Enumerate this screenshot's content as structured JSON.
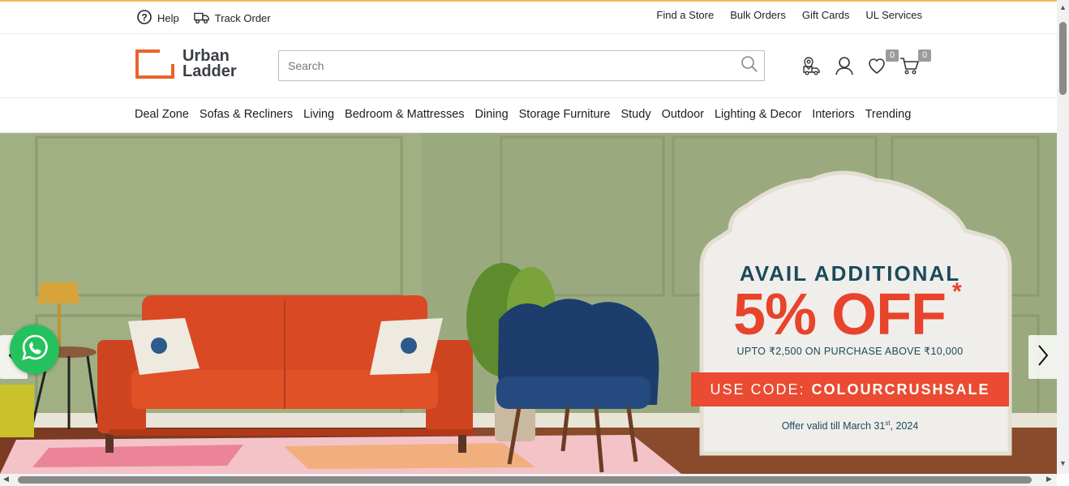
{
  "topbar": {
    "help": "Help",
    "track_order": "Track Order",
    "links": [
      "Find a Store",
      "Bulk Orders",
      "Gift Cards",
      "UL Services"
    ]
  },
  "header": {
    "logo_line1": "Urban",
    "logo_line2": "Ladder",
    "search_placeholder": "Search",
    "wishlist_count": "0",
    "cart_count": "0"
  },
  "nav": {
    "items": [
      "Deal Zone",
      "Sofas & Recliners",
      "Living",
      "Bedroom & Mattresses",
      "Dining",
      "Storage Furniture",
      "Study",
      "Outdoor",
      "Lighting & Decor",
      "Interiors",
      "Trending"
    ]
  },
  "hero": {
    "headline": "AVAIL ADDITIONAL",
    "discount": "5% OFF",
    "asterisk": "*",
    "subline": "UPTO ₹2,500 ON PURCHASE ABOVE ₹10,000",
    "code_prefix": "USE CODE:",
    "code": "COLOURCRUSHSALE",
    "valid_prefix": "Offer valid till March 31",
    "valid_sup": "st",
    "valid_suffix": ", 2024"
  },
  "colors": {
    "accent_orange": "#ea4b32",
    "brand_teal": "#1b4a5c",
    "whatsapp_green": "#25c15e",
    "wall_green": "#96a67a"
  },
  "icons": [
    "help-icon",
    "truck-icon",
    "search-icon",
    "delivery-icon",
    "user-icon",
    "heart-icon",
    "cart-icon",
    "whatsapp-icon",
    "chevron-left-icon",
    "chevron-right-icon"
  ]
}
